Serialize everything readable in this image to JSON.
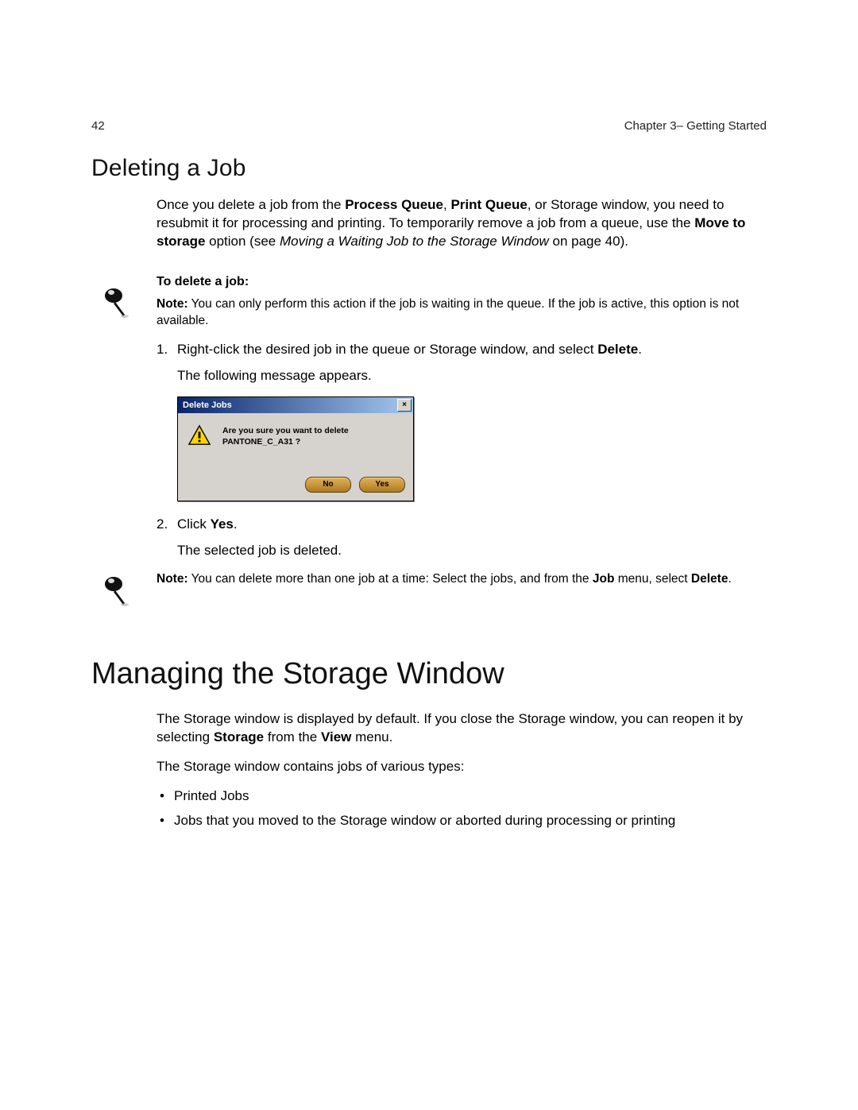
{
  "header": {
    "page_number": "42",
    "chapter_label": "Chapter 3– Getting Started"
  },
  "section1": {
    "title": "Deleting a Job",
    "intro_parts": {
      "p1": "Once you delete a job from the ",
      "b1": "Process Queue",
      "p2": ", ",
      "b2": "Print Queue",
      "p3": ", or Storage window, you need to resubmit it for processing and printing. To temporarily remove a job from a queue, use the ",
      "b3": "Move to storage",
      "p4": " option (see ",
      "i1": "Moving a Waiting Job to the Storage Window",
      "p5": " on page 40)."
    },
    "sub_heading": "To delete a job:",
    "note1": {
      "label": "Note:",
      "text": "  You can only perform this action if the job is waiting in the queue. If the job is active, this option is not available."
    },
    "step1": {
      "num": "1.",
      "text_a": "Right-click the desired job in the queue or Storage window, and select ",
      "bold": "Delete",
      "text_b": "."
    },
    "step1_follow": "The following message appears.",
    "dialog": {
      "title": "Delete Jobs",
      "close": "×",
      "message": "Are you sure you want to delete PANTONE_C_A31 ?",
      "btn_no": "No",
      "btn_yes": "Yes"
    },
    "step2": {
      "num": "2.",
      "text_a": "Click ",
      "bold": "Yes",
      "text_b": "."
    },
    "step2_follow": "The selected job is deleted.",
    "note2": {
      "label": "Note:",
      "text_a": "  You can delete more than one job at a time: Select the jobs, and from the ",
      "bold1": "Job",
      "text_b": " menu, select ",
      "bold2": "Delete",
      "text_c": "."
    }
  },
  "section2": {
    "title": "Managing the Storage Window",
    "p1": {
      "a": "The Storage window is displayed by default. If you close the Storage window, you can reopen it by selecting ",
      "b1": "Storage",
      "b": " from the ",
      "b2": "View",
      "c": " menu."
    },
    "p2": "The Storage window contains jobs of various types:",
    "bullets": {
      "b1": "Printed Jobs",
      "b2": "Jobs that you moved to the Storage window or aborted during processing or printing"
    }
  }
}
